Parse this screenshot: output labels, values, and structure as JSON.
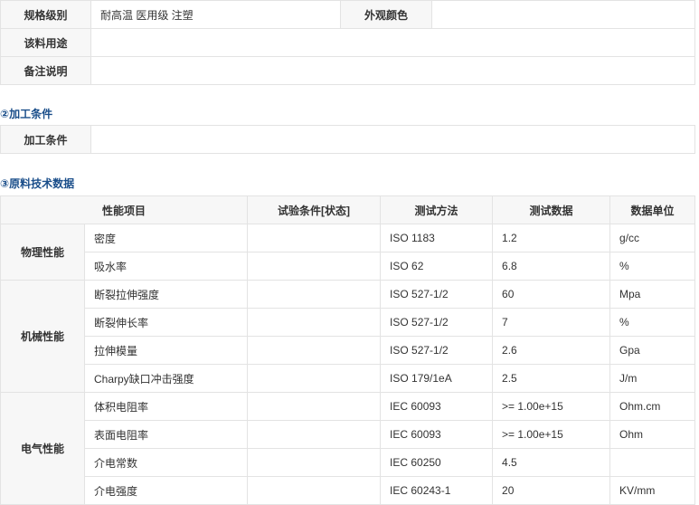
{
  "basic": {
    "spec_label": "规格级别",
    "spec_value": "耐高温 医用级 注塑",
    "color_label": "外观颜色",
    "color_value": "",
    "use_label": "该料用途",
    "use_value": "",
    "note_label": "备注说明",
    "note_value": ""
  },
  "processing": {
    "title": "②加工条件",
    "label": "加工条件",
    "value": ""
  },
  "tech": {
    "title": "③原料技术数据",
    "headers": [
      "性能项目",
      "试验条件[状态]",
      "测试方法",
      "测试数据",
      "数据单位"
    ],
    "groups": [
      {
        "name": "物理性能",
        "rows": [
          {
            "item": "密度",
            "condition": "",
            "method": "ISO 1183",
            "value": "1.2",
            "unit": "g/cc"
          },
          {
            "item": "吸水率",
            "condition": "",
            "method": "ISO 62",
            "value": "6.8",
            "unit": "%"
          }
        ]
      },
      {
        "name": "机械性能",
        "rows": [
          {
            "item": "断裂拉伸强度",
            "condition": "",
            "method": "ISO 527-1/2",
            "value": "60",
            "unit": "Mpa"
          },
          {
            "item": "断裂伸长率",
            "condition": "",
            "method": "ISO 527-1/2",
            "value": "7",
            "unit": "%"
          },
          {
            "item": "拉伸模量",
            "condition": "",
            "method": "ISO 527-1/2",
            "value": "2.6",
            "unit": "Gpa"
          },
          {
            "item": "Charpy缺口冲击强度",
            "condition": "",
            "method": "ISO 179/1eA",
            "value": "2.5",
            "unit": "J/m"
          }
        ]
      },
      {
        "name": "电气性能",
        "rows": [
          {
            "item": "体积电阻率",
            "condition": "",
            "method": "IEC 60093",
            "value": ">= 1.00e+15",
            "unit": "Ohm.cm"
          },
          {
            "item": "表面电阻率",
            "condition": "",
            "method": "IEC 60093",
            "value": ">= 1.00e+15",
            "unit": "Ohm"
          },
          {
            "item": "介电常数",
            "condition": "",
            "method": "IEC 60250",
            "value": "4.5",
            "unit": ""
          },
          {
            "item": "介电强度",
            "condition": "",
            "method": "IEC 60243-1",
            "value": "20",
            "unit": "KV/mm"
          }
        ]
      }
    ]
  }
}
